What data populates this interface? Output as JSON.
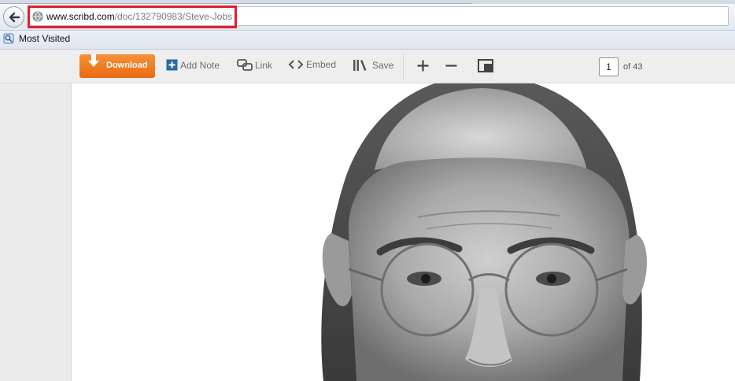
{
  "browser": {
    "url_domain": "www.scribd.com",
    "url_path": "/doc/132790983/Steve-Jobs",
    "bookmarks": [
      {
        "label": "Most Visited",
        "icon": "most-visited-icon"
      }
    ]
  },
  "toolbar": {
    "download_label": "Download",
    "add_note_label": "Add Note",
    "link_label": "Link",
    "embed_label": "Embed",
    "save_label": "Save",
    "current_page": "1",
    "page_total": "of 43"
  },
  "colors": {
    "download_button": "#ee7320",
    "url_highlight": "#e0202a"
  }
}
